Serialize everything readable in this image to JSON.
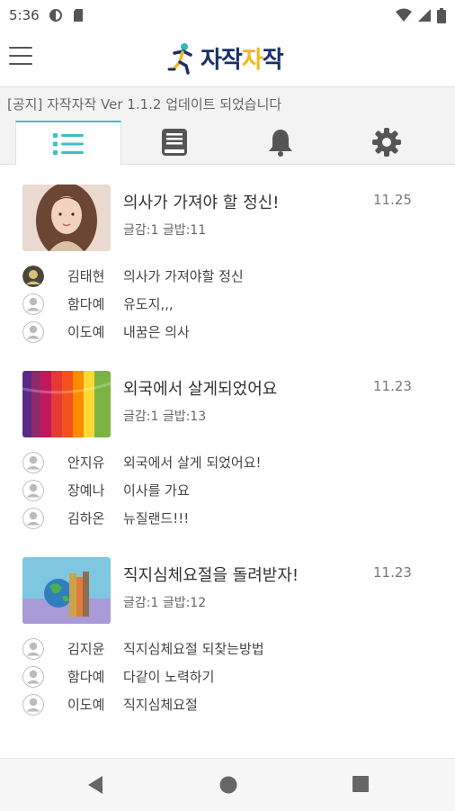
{
  "status_bar": {
    "time": "5:36",
    "icons": [
      "data-saver-icon",
      "sd-card-icon",
      "wifi-icon",
      "signal-icon",
      "battery-icon"
    ]
  },
  "app": {
    "logo_part1": "자작",
    "logo_part2": "자",
    "logo_part3": "작",
    "menu_icon": "hamburger-menu-icon"
  },
  "notice": {
    "text": "[공지] 자작자작 Ver 1.1.2 업데이트 되었습니다"
  },
  "tabs": [
    {
      "icon": "list-icon",
      "active": true
    },
    {
      "icon": "book-icon",
      "active": false
    },
    {
      "icon": "bell-icon",
      "active": false
    },
    {
      "icon": "gear-icon",
      "active": false
    }
  ],
  "posts": [
    {
      "title": "의사가 가져야 할 정신!",
      "date": "11.25",
      "meta": "글감:1 글밥:11",
      "comments": [
        {
          "name": "김태현",
          "text": "의사가 가져야할 정신"
        },
        {
          "name": "함다예",
          "text": "유도지,,,"
        },
        {
          "name": "이도예",
          "text": "내꿈은 의사"
        }
      ]
    },
    {
      "title": "외국에서 살게되었어요",
      "date": "11.23",
      "meta": "글감:1 글밥:13",
      "comments": [
        {
          "name": "안지유",
          "text": "외국에서 살게 되었어요!"
        },
        {
          "name": "장예나",
          "text": "이사를 가요"
        },
        {
          "name": "김하온",
          "text": "뉴질랜드!!!"
        }
      ]
    },
    {
      "title": "직지심체요절을 돌려받자!",
      "date": "11.23",
      "meta": "글감:1 글밥:12",
      "comments": [
        {
          "name": "김지윤",
          "text": "직지심체요절 되찾는방법"
        },
        {
          "name": "함다예",
          "text": "다같이 노력하기"
        },
        {
          "name": "이도예",
          "text": "직지심체요절"
        }
      ]
    }
  ],
  "colors": {
    "accent": "#3ec0c0",
    "logo_navy": "#1a2f6b",
    "logo_yellow": "#f1b81c"
  }
}
